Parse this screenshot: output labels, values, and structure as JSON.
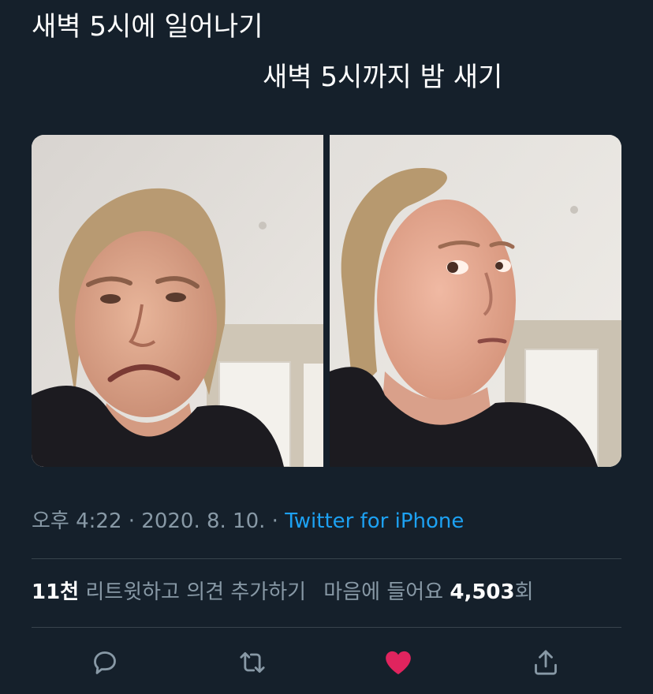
{
  "tweet": {
    "line1": "새벽 5시에 일어나기",
    "line2": "새벽 5시까지 밤 새기",
    "timestamp": "오후 4:22 · 2020. 8. 10. · ",
    "source": "Twitter for iPhone",
    "retweets_count": "11천",
    "retweets_label": "리트윗",
    "quote_label": "하고 의견 추가하기",
    "likes_label": "마음에 들어요",
    "likes_count": "4,503",
    "likes_suffix": "회"
  },
  "media": [
    {
      "name": "meme-photo-left",
      "expression": "grimace"
    },
    {
      "name": "meme-photo-right",
      "expression": "side-glance"
    }
  ],
  "actions": {
    "reply_icon": "reply-icon",
    "retweet_icon": "retweet-icon",
    "like_icon": "heart-icon",
    "share_icon": "share-icon"
  },
  "colors": {
    "background": "#15202b",
    "text": "#ffffff",
    "secondary": "#8899a6",
    "link": "#1da1f2",
    "like": "#e0245e",
    "divider": "#38444d"
  }
}
